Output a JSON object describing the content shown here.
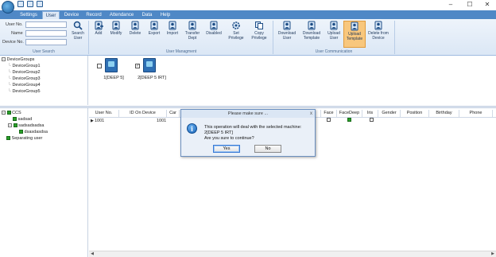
{
  "window": {
    "controls": [
      "–",
      "☐",
      "✕"
    ]
  },
  "menu": {
    "tabs": [
      "Settings",
      "User",
      "Device",
      "Record",
      "Attendance",
      "Data",
      "Help"
    ],
    "active_tab": "User"
  },
  "ribbon": {
    "user_search": {
      "fields": [
        "User No.",
        "Name",
        "Device No."
      ],
      "search_button": [
        "Search",
        "User"
      ],
      "group_label": "User Search"
    },
    "user_management": {
      "buttons": [
        {
          "label": [
            "Add"
          ],
          "icon": "add-user-icon"
        },
        {
          "label": [
            "Modify"
          ],
          "icon": "edit-user-icon"
        },
        {
          "label": [
            "Delete"
          ],
          "icon": "delete-user-icon"
        },
        {
          "label": [
            "Export"
          ],
          "icon": "export-icon"
        },
        {
          "label": [
            "Import"
          ],
          "icon": "import-icon"
        },
        {
          "label": [
            "Transfer",
            "Dept"
          ],
          "icon": "transfer-icon"
        },
        {
          "label": [
            "Disabled"
          ],
          "icon": "disable-user-icon"
        },
        {
          "label": [
            "Set",
            "Privilege"
          ],
          "icon": "gear-icon"
        },
        {
          "label": [
            "Copy",
            "Privilege"
          ],
          "icon": "copy-icon"
        }
      ],
      "group_label": "User Managment"
    },
    "user_communication": {
      "buttons": [
        {
          "label": [
            "Download",
            "User"
          ],
          "icon": "download-user-icon"
        },
        {
          "label": [
            "Download",
            "Template"
          ],
          "icon": "download-template-icon"
        },
        {
          "label": [
            "Upload",
            "User"
          ],
          "icon": "upload-user-icon"
        },
        {
          "label": [
            "Upload",
            "Template"
          ],
          "icon": "upload-template-icon"
        },
        {
          "label": [
            "Delete from",
            "Device"
          ],
          "icon": "delete-from-device-icon"
        }
      ],
      "group_label": "User Communication"
    }
  },
  "device_tree": {
    "root": "DeviceGroups",
    "groups": [
      "DeviceGroup1",
      "DeviceGroup2",
      "DeviceGroup3",
      "DeviceGroup4",
      "DeviceGroup5"
    ]
  },
  "devices": [
    {
      "label": "1[DEEP 5]",
      "checked": false
    },
    {
      "label": "2[DEEP 5 IRT]",
      "checked": true
    }
  ],
  "org_tree": {
    "root": "CCS",
    "child": "sadsad",
    "subchild": "sadsadsadsa",
    "leaf": "dsasdasdsa",
    "other": "Separating user"
  },
  "table": {
    "headers": [
      "User No.",
      "ID On Device",
      "Car",
      "?",
      "Face",
      "FaceDeep",
      "Iris",
      "Gender",
      "Position",
      "Birthday",
      "Phone"
    ],
    "rows": [
      {
        "marker": "▶",
        "user_no": "1001",
        "id_on_device": "1001"
      }
    ]
  },
  "dialog": {
    "title": "Please make sure ...",
    "close": "x",
    "message_line1": "This operation will deal with the selected machine:",
    "message_line2": "2[DEEP 5 IRT]",
    "message_line3": "Are you sure to continue?",
    "yes": "Yes",
    "no": "No"
  },
  "colors": {
    "menubar": "#4f88c6",
    "active_button": "#f8c77d",
    "dialog_bg": "#eaf0f8",
    "tree_green": "#2aa02a"
  }
}
